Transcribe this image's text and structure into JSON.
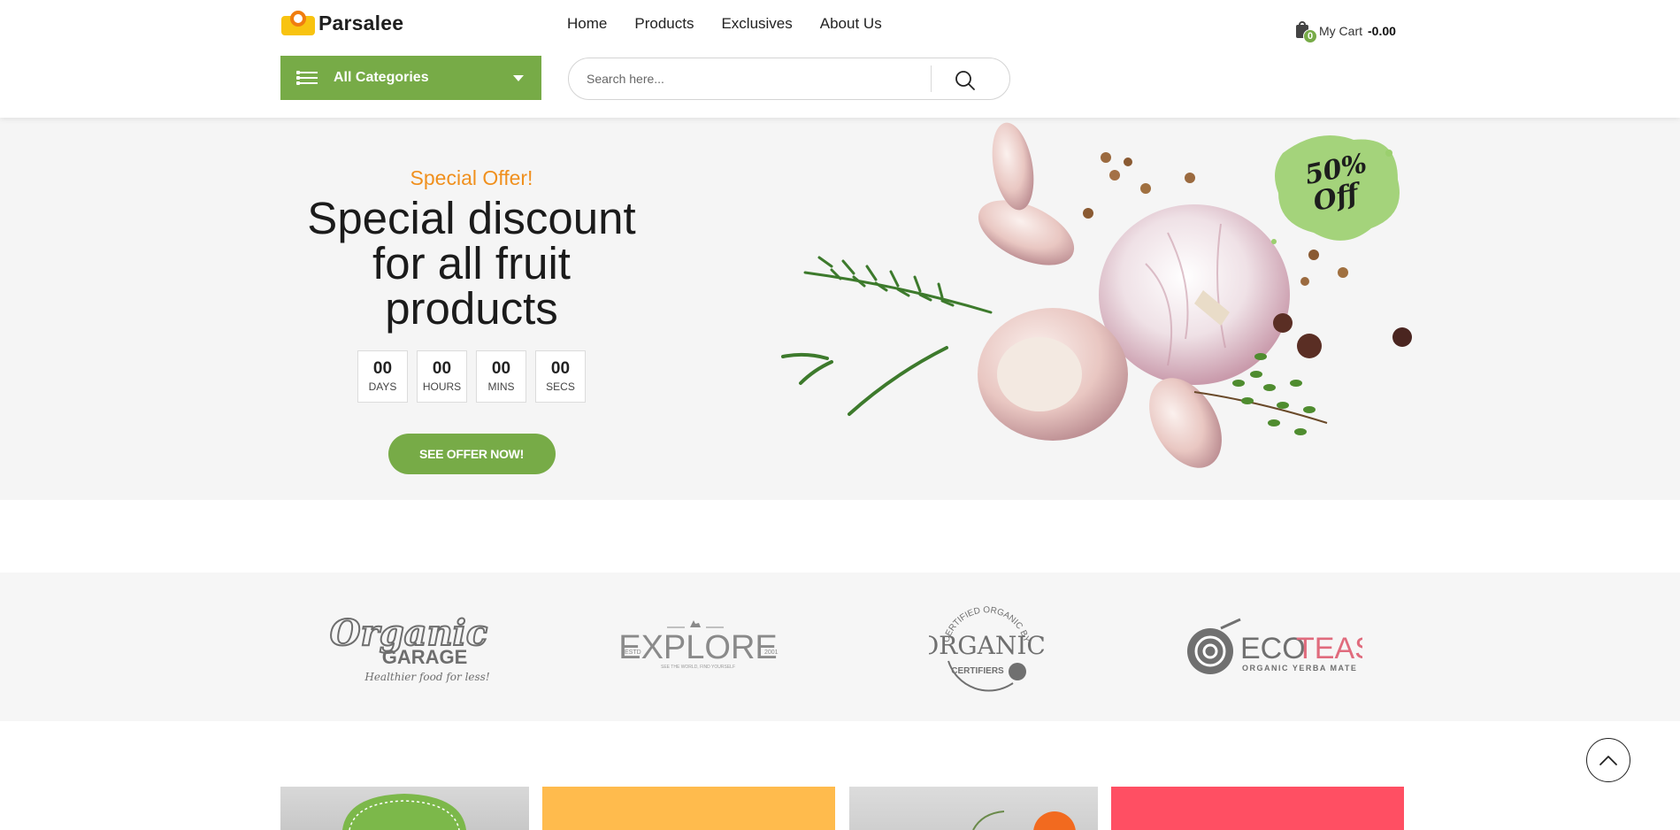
{
  "header": {
    "logo_text": "Parsalee",
    "nav": [
      {
        "label": "Home"
      },
      {
        "label": "Products"
      },
      {
        "label": "Exclusives"
      },
      {
        "label": "About Us"
      }
    ],
    "cart": {
      "count": "0",
      "label": "My Cart",
      "total": "-0.00"
    },
    "categories_label": "All Categories",
    "search_placeholder": "Search here..."
  },
  "hero": {
    "eyebrow": "Special Offer!",
    "headline_line1": "Special discount",
    "headline_line2": "for all fruit products",
    "countdown": [
      {
        "value": "00",
        "unit": "DAYS"
      },
      {
        "value": "00",
        "unit": "HOURS"
      },
      {
        "value": "00",
        "unit": "MINS"
      },
      {
        "value": "00",
        "unit": "SECS"
      }
    ],
    "cta_label": "SEE OFFER NOW!",
    "badge_line1": "50%",
    "badge_line2": "Off"
  },
  "brands": [
    {
      "name": "Organic",
      "name2": "GARAGE",
      "tagline": "Healthier food for less!"
    },
    {
      "name": "EXPLORE",
      "left": "ESTD",
      "right": "2001",
      "tagline": "SEE THE WORLD, FIND YOURSELF"
    },
    {
      "arc": "CERTIFIED ORGANIC BY",
      "name": "ORGANIC",
      "sub": "CERTIFIERS"
    },
    {
      "name_a": "ECO",
      "name_b": "TEAS",
      "tagline": "ORGANIC YERBA MATE"
    }
  ],
  "colors": {
    "accent_green": "#77ab47",
    "offer_orange": "#f0901e",
    "card_yellow": "#ffbb4d",
    "card_pink": "#ff4f63"
  }
}
